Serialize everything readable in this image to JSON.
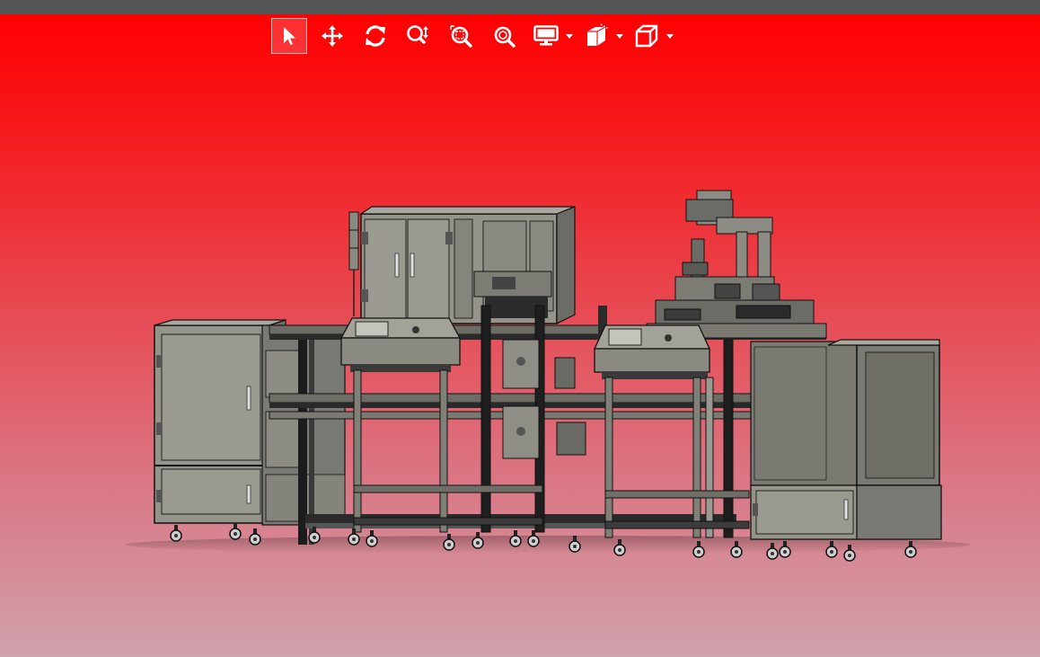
{
  "colors": {
    "titlebar": "#555555",
    "background_top": "#ff0000",
    "background_bottom": "#cfa2ac",
    "icon": "#ffffff",
    "machine_panel": "#8e8e86",
    "machine_frame": "#1a1a1a"
  },
  "toolbar": {
    "tools": [
      {
        "icon": "select-arrow-icon",
        "active": true
      },
      {
        "icon": "pan-move-icon",
        "active": false
      },
      {
        "icon": "rotate-icon",
        "active": false
      },
      {
        "icon": "zoom-icon",
        "active": false
      },
      {
        "icon": "zoom-window-icon",
        "active": false
      },
      {
        "icon": "zoom-fit-icon",
        "active": false
      }
    ],
    "dropdowns": [
      {
        "icon": "display-mode-icon"
      },
      {
        "icon": "section-view-icon"
      },
      {
        "icon": "view-cube-icon"
      }
    ]
  },
  "model": {
    "description_icon": "assembly-line-machine"
  }
}
